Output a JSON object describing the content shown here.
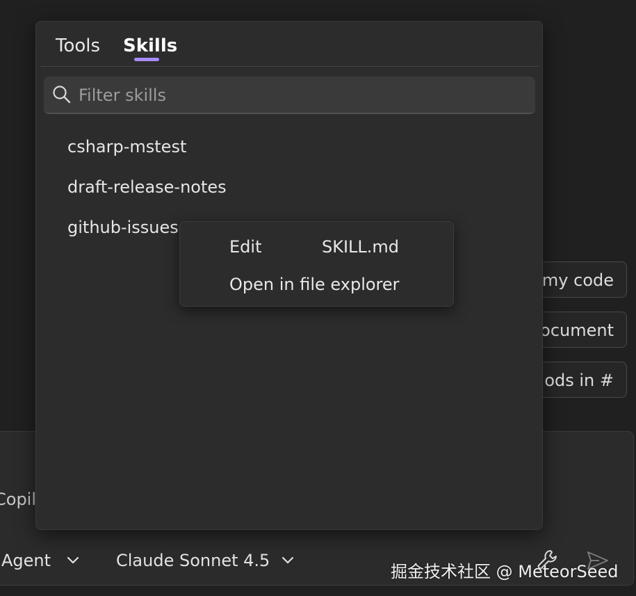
{
  "background": {
    "suggestions": [
      "my code",
      "ocument",
      "ods in #"
    ],
    "input_placeholder": "Copil",
    "toolbar": {
      "mode": "Agent",
      "model": "Claude Sonnet 4.5",
      "tools_icon": "wrench-icon",
      "send_icon": "send-icon"
    }
  },
  "popup": {
    "tabs": [
      {
        "label": "Tools",
        "selected": false
      },
      {
        "label": "Skills",
        "selected": true
      }
    ],
    "filter": {
      "placeholder": "Filter skills",
      "value": "",
      "icon": "search-icon"
    },
    "skills": [
      {
        "label": "csharp-mstest"
      },
      {
        "label": "draft-release-notes"
      },
      {
        "label": "github-issues"
      }
    ]
  },
  "context_menu": {
    "edit_label": "Edit",
    "edit_target": "SKILL.md",
    "open_label": "Open in file explorer"
  },
  "watermark": "掘金技术社区 @ MeteorSeed",
  "colors": {
    "accent": "#a78bfa",
    "background": "#202020",
    "panel": "#2c2c2c"
  }
}
